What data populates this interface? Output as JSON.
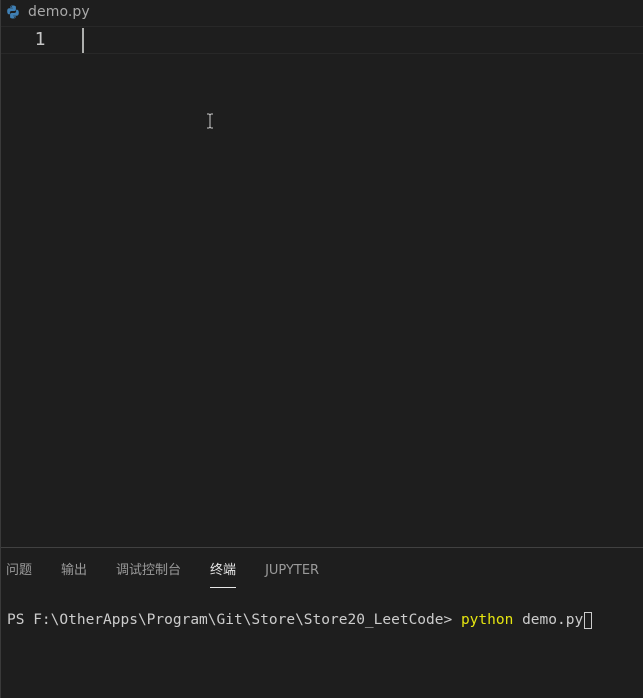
{
  "breadcrumb": {
    "file_icon": "python-icon",
    "file_name": "demo.py"
  },
  "editor": {
    "line_numbers": [
      "1"
    ],
    "lines": [
      ""
    ]
  },
  "panel": {
    "tabs": [
      {
        "label": "问题",
        "active": false
      },
      {
        "label": "输出",
        "active": false
      },
      {
        "label": "调试控制台",
        "active": false
      },
      {
        "label": "终端",
        "active": true
      },
      {
        "label": "JUPYTER",
        "active": false
      }
    ]
  },
  "terminal": {
    "prompt": "PS F:\\OtherApps\\Program\\Git\\Store\\Store20_LeetCode> ",
    "command": "python",
    "args": " demo.py"
  },
  "colors": {
    "background": "#1e1e1e",
    "python_blue": "#3f80b5",
    "python_yellow": "#f7c93c",
    "command_yellow": "#e5e510"
  }
}
